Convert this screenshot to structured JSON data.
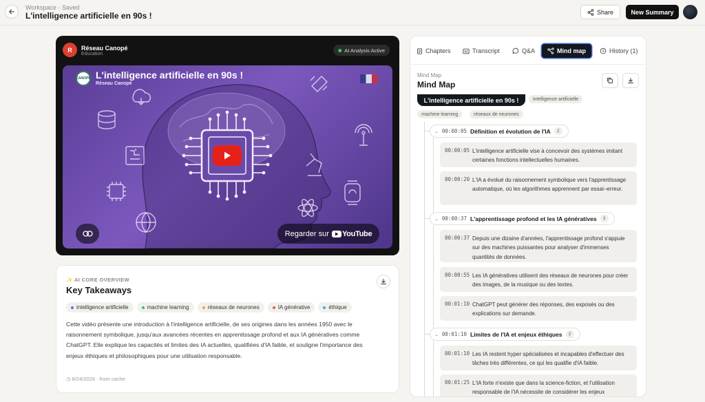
{
  "header": {
    "breadcrumb": "Workspace · Saved",
    "title": "L'intelligence artificielle en 90s !",
    "share_label": "Share",
    "new_summary_label": "New Summary"
  },
  "video": {
    "channel_initial": "R",
    "channel_name": "Réseau Canopé",
    "channel_category": "Education",
    "ai_status": "AI Analysis Active",
    "video_title": "L'intelligence artificielle en 90s !",
    "video_subtitle": "Réseau Canopé",
    "logo_text": "CANOPÉ",
    "watch_label": "Regarder sur",
    "youtube_label": "YouTube"
  },
  "takeaways": {
    "eyebrow": "✨ AI CORE OVERVIEW",
    "title": "Key Takeaways",
    "tags": [
      {
        "label": "intelligence artificielle",
        "color": "#5b6ee1"
      },
      {
        "label": "machine learning",
        "color": "#3bb67a"
      },
      {
        "label": "réseaux de neurones",
        "color": "#e5a53b"
      },
      {
        "label": "IA générative",
        "color": "#e2574c"
      },
      {
        "label": "éthique",
        "color": "#3ba6d9"
      }
    ],
    "body": "Cette vidéo présente une introduction à l'intelligence artificielle, de ses origines dans les années 1950 avec le raisonnement symbolique, jusqu'aux avancées récentes en apprentissage profond et aux IA génératives comme ChatGPT. Elle explique les capacités et limites des IA actuelles, qualifiées d'IA faible, et souligne l'importance des enjeux éthiques et philosophiques pour une utilisation responsable.",
    "footer": "8/24/2026 · from cache"
  },
  "panel": {
    "tabs": [
      {
        "label": "Chapters",
        "icon": "document-icon"
      },
      {
        "label": "Transcript",
        "icon": "transcript-icon"
      },
      {
        "label": "Q&A",
        "icon": "chat-icon"
      },
      {
        "label": "Mind map",
        "icon": "mindmap-icon"
      },
      {
        "label": "History (1)",
        "icon": "history-icon"
      }
    ],
    "active_tab": "Mind map",
    "eyebrow": "Mind Map",
    "title": "Mind Map",
    "root": "L'intelligence artificielle en 90s !",
    "root_tags": [
      "intelligence artificielle",
      "machine learning",
      "réseaux de neurones"
    ],
    "sections": [
      {
        "time": "00:00:05",
        "title": "Définition et évolution de l'IA",
        "count": "2",
        "items": [
          {
            "time": "00:00:05",
            "text": "L'intelligence artificielle vise à concevoir des systèmes imitant certaines fonctions intellectuelles humaines."
          },
          {
            "time": "00:00:20",
            "text": "L'IA a évolué du raisonnement symbolique vers l'apprentissage automatique, où les algorithmes apprennent par essai–erreur."
          }
        ]
      },
      {
        "time": "00:00:37",
        "title": "L'apprentissage profond et les IA génératives",
        "count": "3",
        "items": [
          {
            "time": "00:00:37",
            "text": "Depuis une dizaine d'années, l'apprentissage profond s'appuie sur des machines puissantes pour analyser d'immenses quantités de données."
          },
          {
            "time": "00:00:55",
            "text": "Les IA génératives utilisent des réseaux de neurones pour créer des images, de la musique ou des textes."
          },
          {
            "time": "00:01:10",
            "text": "ChatGPT peut générer des réponses, des exposés ou des explications sur demande."
          }
        ]
      },
      {
        "time": "00:01:10",
        "title": "Limites de l'IA et enjeux éthiques",
        "count": "2",
        "items": [
          {
            "time": "00:01:10",
            "text": "Les IA restent hyper spécialisées et incapables d'effectuer des tâches très différentes, ce qui les qualifie d'IA faible."
          },
          {
            "time": "00:01:25",
            "text": "L'IA forte n'existe que dans la science-fiction, et l'utilisation responsable de l'IA nécessite de considérer les enjeux"
          }
        ]
      }
    ]
  }
}
